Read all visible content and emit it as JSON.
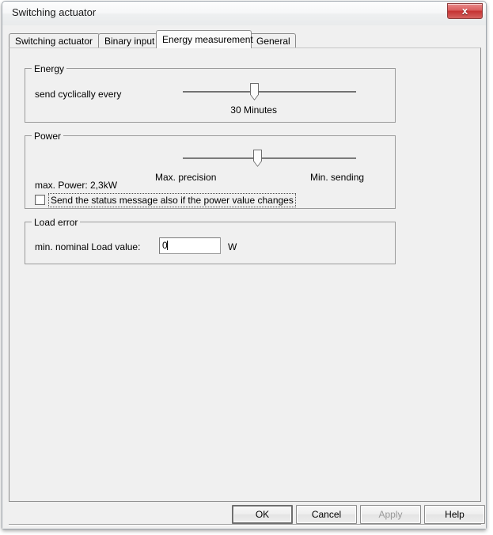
{
  "window": {
    "title": "Switching actuator",
    "close_label": "x",
    "close_icon": "close-icon"
  },
  "tabs": [
    {
      "label": "Switching actuator",
      "selected": false
    },
    {
      "label": "Binary input",
      "selected": false
    },
    {
      "label": "Energy measurement",
      "selected": true
    },
    {
      "label": "General",
      "selected": false
    }
  ],
  "energy_group": {
    "legend": "Energy",
    "send_label": "send cyclically every",
    "slider_value_label": "30 Minutes",
    "slider_percent": 41
  },
  "power_group": {
    "legend": "Power",
    "slider_percent": 43,
    "slider_min_label": "Max. precision",
    "slider_max_label": "Min. sending",
    "max_power_label": "max. Power: 2,3kW",
    "checkbox_label": "Send the status message also if the power value changes",
    "checkbox_checked": false
  },
  "load_error_group": {
    "legend": "Load error",
    "field_label": "min. nominal Load value:",
    "field_value": "0",
    "field_placeholder": "",
    "unit_label": "W"
  },
  "buttons": {
    "ok": "OK",
    "cancel": "Cancel",
    "apply": "Apply",
    "help": "Help"
  }
}
